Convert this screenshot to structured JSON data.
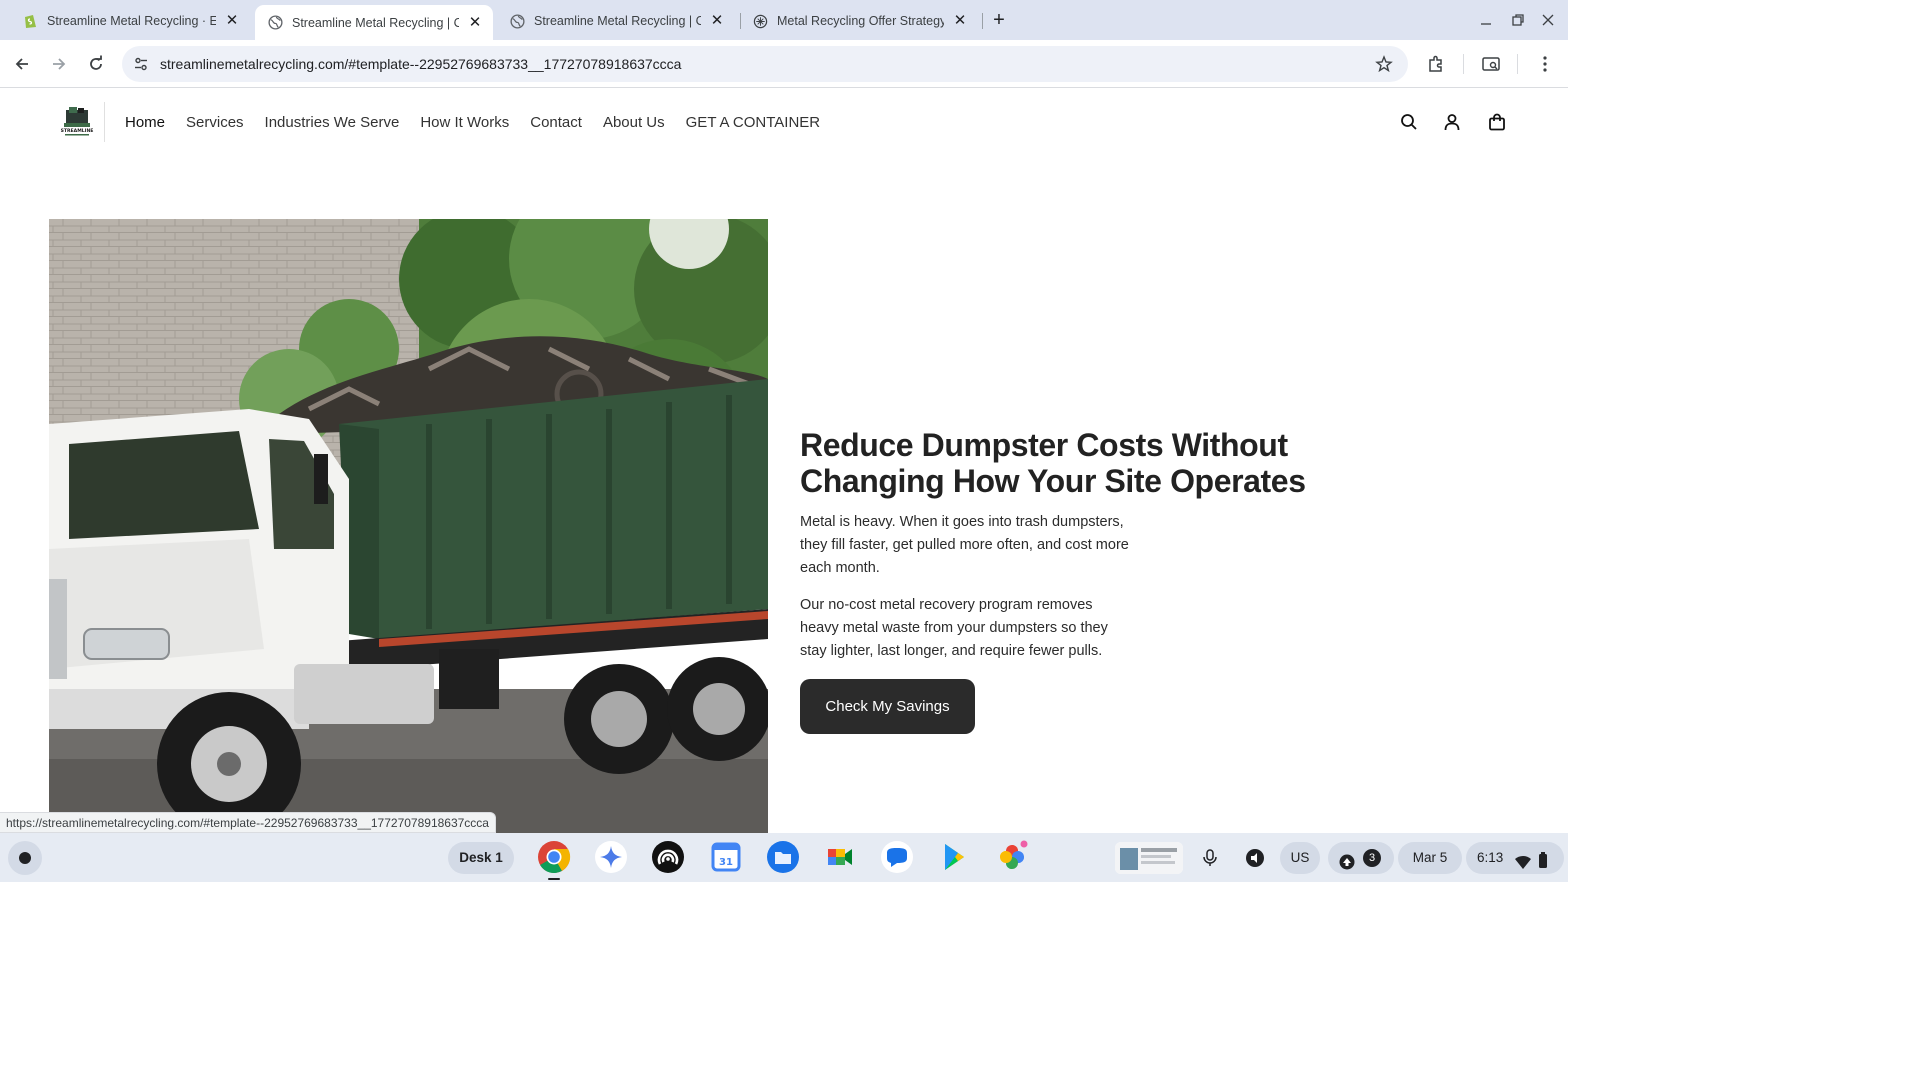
{
  "browser": {
    "tabs": [
      {
        "title": "Streamline Metal Recycling · Edit",
        "favicon": "shopify-icon",
        "active": false
      },
      {
        "title": "Streamline Metal Recycling | Commercial",
        "favicon": "globe-icon",
        "active": true
      },
      {
        "title": "Streamline Metal Recycling | Commercial",
        "favicon": "globe-icon",
        "active": false
      },
      {
        "title": "Metal Recycling Offer Strategy",
        "favicon": "openai-icon",
        "active": false
      }
    ],
    "new_tab": "+",
    "url": "streamlinemetalrecycling.com/#template--22952769683733__17727078918637ccca",
    "status_url": "https://streamlinemetalrecycling.com/#template--22952769683733__17727078918637ccca"
  },
  "site": {
    "logo_text": "STREAMLINE",
    "nav": [
      "Home",
      "Services",
      "Industries We Serve",
      "How It Works",
      "Contact",
      "About Us",
      "GET A CONTAINER"
    ],
    "hero": {
      "title": "Reduce Dumpster Costs Without Changing How Your Site Operates",
      "p1": "Metal is heavy. When it goes into trash dumpsters, they fill faster, get pulled more often, and cost more each month.",
      "p2": "Our no-cost metal recovery program removes heavy metal waste from your dumpsters so they stay lighter, last longer, and require fewer pulls.",
      "cta": "Check My Savings"
    }
  },
  "shelf": {
    "desk": "Desk 1",
    "calendar_day": "31",
    "ime": "US",
    "notification_count": "3",
    "date": "Mar 5",
    "time": "6:13"
  },
  "colors": {
    "accent_button": "#2b2b2b",
    "tabbar_bg": "#dde3f1",
    "shelf_bg": "#e6ebf3"
  }
}
